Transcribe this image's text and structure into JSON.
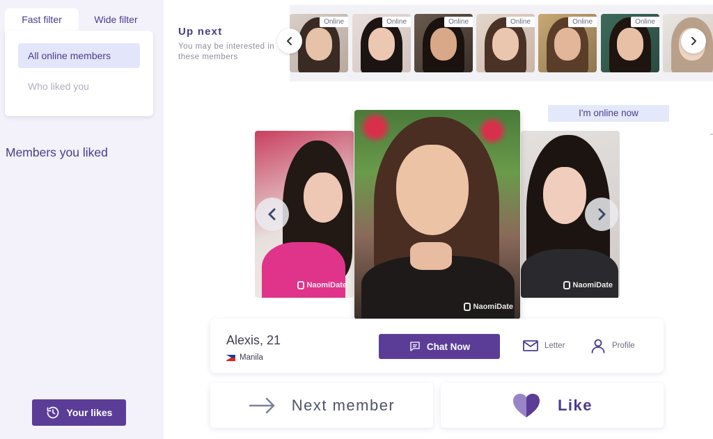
{
  "sidebar": {
    "tabs": [
      {
        "label": "Fast filter",
        "active": true
      },
      {
        "label": "Wide filter",
        "active": false
      }
    ],
    "filter_options": [
      {
        "label": "All online members",
        "active": true
      },
      {
        "label": "Who liked you",
        "active": false
      }
    ],
    "liked_section_title": "Members you liked",
    "your_likes_label": "Your likes"
  },
  "up_next": {
    "title": "Up next",
    "subtitle": "You may be interested in these members",
    "badge_label": "Online",
    "thumbnails": [
      {
        "badge": "Online"
      },
      {
        "badge": "Online"
      },
      {
        "badge": "Online"
      },
      {
        "badge": "Online"
      },
      {
        "badge": "Online"
      },
      {
        "badge": "Online"
      },
      {
        "badge": ""
      }
    ]
  },
  "status_label": "I'm online now",
  "watermark": "NaomiDate",
  "member": {
    "name": "Alexis, 21",
    "city": "Manila"
  },
  "card_actions": {
    "chat_label": "Chat Now",
    "letter_label": "Letter",
    "profile_label": "Profile"
  },
  "bottom_actions": {
    "next_label": "Next member",
    "like_label": "Like"
  },
  "colors": {
    "brand_purple": "#5b3d98",
    "text_purple": "#4a3a8c",
    "sidebar_bg": "#f3f2fa",
    "highlight": "#e3e6fb"
  }
}
